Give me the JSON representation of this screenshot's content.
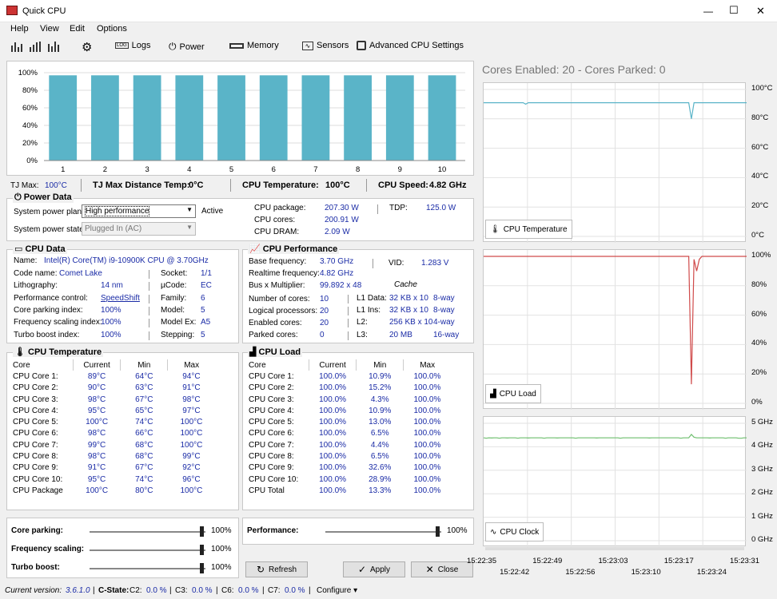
{
  "window": {
    "title": "Quick CPU",
    "min": "—",
    "max": "☐",
    "close": "✕"
  },
  "menu": [
    "Help",
    "View",
    "Edit",
    "Options"
  ],
  "toolbar": {
    "logs": "Logs",
    "power": "Power",
    "memory": "Memory",
    "sensors": "Sensors",
    "advanced": "Advanced CPU Settings"
  },
  "cores_header": "Cores Enabled: 20 - Cores Parked: 0",
  "chart_data": [
    {
      "type": "bar",
      "categories": [
        "1",
        "2",
        "3",
        "4",
        "5",
        "6",
        "7",
        "8",
        "9",
        "10"
      ],
      "values": [
        97,
        97,
        97,
        97,
        97,
        97,
        97,
        97,
        97,
        97
      ],
      "yticks": [
        "100%",
        "80%",
        "60%",
        "40%",
        "20%",
        "0%"
      ],
      "ylim": [
        0,
        100
      ],
      "color": "#5ab4c8"
    },
    {
      "type": "line",
      "title": "CPU Temperature",
      "yticks": [
        "100°C",
        "80°C",
        "60°C",
        "40°C",
        "20°C",
        "0°C"
      ],
      "ylim": [
        0,
        100
      ],
      "color": "#5ab4c8",
      "x": [
        "15:22:35",
        "15:22:49",
        "15:23:03",
        "15:23:17",
        "15:23:31"
      ],
      "values": [
        91,
        91,
        91,
        91,
        91,
        91,
        91,
        91,
        91,
        91,
        91,
        91,
        91,
        91,
        91,
        91,
        90,
        91,
        91,
        91,
        91,
        91,
        91,
        91,
        91,
        91,
        91,
        91,
        91,
        91,
        91,
        91,
        91,
        91,
        91,
        91,
        91,
        91,
        91,
        91,
        91,
        91,
        91,
        91,
        91,
        91,
        91,
        91,
        91,
        91,
        91,
        91,
        91,
        91,
        91,
        91,
        91,
        91,
        91,
        91,
        91,
        91,
        91,
        91,
        91,
        91,
        91,
        91,
        91,
        91,
        91,
        91,
        91,
        91,
        91,
        91,
        91,
        91,
        91,
        80,
        91,
        91,
        91,
        91,
        91,
        91,
        91,
        91,
        91,
        91,
        91,
        91,
        91,
        91,
        91,
        91,
        91,
        91,
        91,
        91,
        91
      ]
    },
    {
      "type": "line",
      "title": "CPU Load",
      "yticks": [
        "100%",
        "80%",
        "60%",
        "40%",
        "20%",
        "0%"
      ],
      "ylim": [
        0,
        100
      ],
      "color": "#d04a4a",
      "values": [
        100,
        100,
        100,
        100,
        100,
        100,
        100,
        100,
        100,
        100,
        100,
        100,
        100,
        100,
        100,
        100,
        100,
        100,
        100,
        100,
        100,
        100,
        100,
        100,
        100,
        100,
        100,
        100,
        100,
        100,
        100,
        100,
        100,
        100,
        100,
        100,
        100,
        100,
        100,
        100,
        100,
        100,
        100,
        100,
        100,
        100,
        100,
        100,
        100,
        100,
        100,
        100,
        100,
        100,
        100,
        100,
        100,
        100,
        100,
        100,
        100,
        100,
        100,
        100,
        100,
        100,
        100,
        100,
        100,
        100,
        100,
        100,
        100,
        100,
        100,
        100,
        100,
        100,
        100,
        13,
        98,
        90,
        98,
        100,
        100,
        100,
        100,
        100,
        100,
        100,
        100,
        100,
        100,
        100,
        100,
        100,
        100,
        100,
        100,
        100,
        100
      ]
    },
    {
      "type": "line",
      "title": "CPU Clock",
      "yticks": [
        "5 GHz",
        "4 GHz",
        "3 GHz",
        "2 GHz",
        "1 GHz",
        "0 GHz"
      ],
      "ylim": [
        0,
        5.5
      ],
      "color": "#6cbe6c",
      "x": [
        "15:22:35",
        "15:22:42",
        "15:22:49",
        "15:22:56",
        "15:23:03",
        "15:23:10",
        "15:23:17",
        "15:23:24",
        "15:23:31"
      ],
      "values": [
        4.82,
        4.8,
        4.82,
        4.81,
        4.82,
        4.82,
        4.8,
        4.82,
        4.82,
        4.81,
        4.82,
        4.82,
        4.82,
        4.8,
        4.82,
        4.82,
        4.82,
        4.81,
        4.82,
        4.82,
        4.82,
        4.82,
        4.82,
        4.8,
        4.82,
        4.82,
        4.82,
        4.82,
        4.81,
        4.82,
        4.82,
        4.82,
        4.82,
        4.82,
        4.82,
        4.8,
        4.82,
        4.82,
        4.82,
        4.82,
        4.82,
        4.82,
        4.82,
        4.81,
        4.82,
        4.82,
        4.82,
        4.82,
        4.82,
        4.82,
        4.82,
        4.82,
        4.8,
        4.82,
        4.82,
        4.82,
        4.82,
        4.82,
        4.82,
        4.82,
        4.82,
        4.82,
        4.82,
        4.81,
        4.82,
        4.82,
        4.82,
        4.82,
        4.82,
        4.82,
        4.82,
        4.82,
        4.82,
        4.82,
        4.82,
        4.8,
        4.82,
        4.82,
        4.82,
        4.98,
        4.85,
        4.82,
        4.82,
        4.82,
        4.82,
        4.82,
        4.81,
        4.82,
        4.82,
        4.82,
        4.82,
        4.82,
        4.8,
        4.82,
        4.82,
        4.82,
        4.82,
        4.8,
        4.8,
        4.82,
        4.82
      ]
    }
  ],
  "summary": {
    "tjmax_label": "TJ Max:",
    "tjmax": "100°C",
    "tjdist_label": "TJ Max Distance Temp:",
    "tjdist": "0°C",
    "cputemp_label": "CPU Temperature:",
    "cputemp": "100°C",
    "cpuspeed_label": "CPU Speed:",
    "cpuspeed": "4.82 GHz"
  },
  "power": {
    "title": "Power Data",
    "plan_label": "System power plan:",
    "plan": "High performance",
    "plan_status": "Active",
    "state_label": "System power state:",
    "state": "Plugged In (AC)",
    "pkg_label": "CPU package:",
    "pkg": "207.30 W",
    "cores_label": "CPU cores:",
    "cores": "200.91 W",
    "dram_label": "CPU DRAM:",
    "dram": "2.09 W",
    "tdp_label": "TDP:",
    "tdp": "125.0 W"
  },
  "cpudata": {
    "title": "CPU Data",
    "name_label": "Name:",
    "name": "Intel(R) Core(TM) i9-10900K CPU @ 3.70GHz",
    "rows": [
      [
        "Code name:",
        "Comet Lake",
        "Socket:",
        "1/1"
      ],
      [
        "Lithography:",
        "14 nm",
        "µCode:",
        "EC"
      ],
      [
        "Performance control:",
        "SpeedShift",
        "Family:",
        "6"
      ],
      [
        "Core parking index:",
        "100%",
        "Model:",
        "5"
      ],
      [
        "Frequency scaling index:",
        "100%",
        "Model Ex:",
        "A5"
      ],
      [
        "Turbo boost index:",
        "100%",
        "Stepping:",
        "5"
      ]
    ]
  },
  "perf": {
    "title": "CPU Performance",
    "rows": [
      [
        "Base frequency:",
        "3.70 GHz"
      ],
      [
        "Realtime frequency:",
        "4.82 GHz"
      ],
      [
        "Bus x Multiplier:",
        "99.892 x 48"
      ],
      [
        "Number of cores:",
        "10"
      ],
      [
        "Logical processors:",
        "20"
      ],
      [
        "Enabled cores:",
        "20"
      ],
      [
        "Parked cores:",
        "0"
      ]
    ],
    "vid_label": "VID:",
    "vid": "1.283 V",
    "cache_label": "Cache",
    "cache": [
      [
        "L1 Data:",
        "32 KB x 10",
        "8-way"
      ],
      [
        "L1 Ins:",
        "32 KB x 10",
        "8-way"
      ],
      [
        "L2:",
        "256 KB x 10",
        "4-way"
      ],
      [
        "L3:",
        "20 MB",
        "16-way"
      ]
    ]
  },
  "temp": {
    "title": "CPU Temperature",
    "headers": [
      "Core",
      "Current",
      "Min",
      "Max"
    ],
    "rows": [
      [
        "CPU Core 1:",
        "89°C",
        "64°C",
        "94°C"
      ],
      [
        "CPU Core 2:",
        "90°C",
        "63°C",
        "91°C"
      ],
      [
        "CPU Core 3:",
        "98°C",
        "67°C",
        "98°C"
      ],
      [
        "CPU Core 4:",
        "95°C",
        "65°C",
        "97°C"
      ],
      [
        "CPU Core 5:",
        "100°C",
        "74°C",
        "100°C"
      ],
      [
        "CPU Core 6:",
        "98°C",
        "66°C",
        "100°C"
      ],
      [
        "CPU Core 7:",
        "99°C",
        "68°C",
        "100°C"
      ],
      [
        "CPU Core 8:",
        "98°C",
        "68°C",
        "99°C"
      ],
      [
        "CPU Core 9:",
        "91°C",
        "67°C",
        "92°C"
      ],
      [
        "CPU Core 10:",
        "95°C",
        "74°C",
        "96°C"
      ],
      [
        "CPU Package",
        "100°C",
        "80°C",
        "100°C"
      ]
    ]
  },
  "load": {
    "title": "CPU Load",
    "headers": [
      "Core",
      "Current",
      "Min",
      "Max"
    ],
    "rows": [
      [
        "CPU Core 1:",
        "100.0%",
        "10.9%",
        "100.0%"
      ],
      [
        "CPU Core 2:",
        "100.0%",
        "15.2%",
        "100.0%"
      ],
      [
        "CPU Core 3:",
        "100.0%",
        "4.3%",
        "100.0%"
      ],
      [
        "CPU Core 4:",
        "100.0%",
        "10.9%",
        "100.0%"
      ],
      [
        "CPU Core 5:",
        "100.0%",
        "13.0%",
        "100.0%"
      ],
      [
        "CPU Core 6:",
        "100.0%",
        "6.5%",
        "100.0%"
      ],
      [
        "CPU Core 7:",
        "100.0%",
        "4.4%",
        "100.0%"
      ],
      [
        "CPU Core 8:",
        "100.0%",
        "6.5%",
        "100.0%"
      ],
      [
        "CPU Core 9:",
        "100.0%",
        "32.6%",
        "100.0%"
      ],
      [
        "CPU Core 10:",
        "100.0%",
        "28.9%",
        "100.0%"
      ],
      [
        "CPU Total",
        "100.0%",
        "13.3%",
        "100.0%"
      ]
    ]
  },
  "sliders": {
    "parking_label": "Core parking:",
    "parking": "100%",
    "freq_label": "Frequency scaling:",
    "freq": "100%",
    "turbo_label": "Turbo boost:",
    "turbo": "100%",
    "perf_label": "Performance:",
    "perf": "100%"
  },
  "buttons": {
    "refresh": "Refresh",
    "apply": "Apply",
    "close": "Close"
  },
  "status": {
    "version_label": "Current version:",
    "version": "3.6.1.0",
    "cstate_label": "C-State:",
    "c2_label": "C2:",
    "c2": "0.0 %",
    "c3_label": "C3:",
    "c3": "0.0 %",
    "c6_label": "C6:",
    "c6": "0.0 %",
    "c7_label": "C7:",
    "c7": "0.0 %",
    "configure": "Configure ▾"
  }
}
